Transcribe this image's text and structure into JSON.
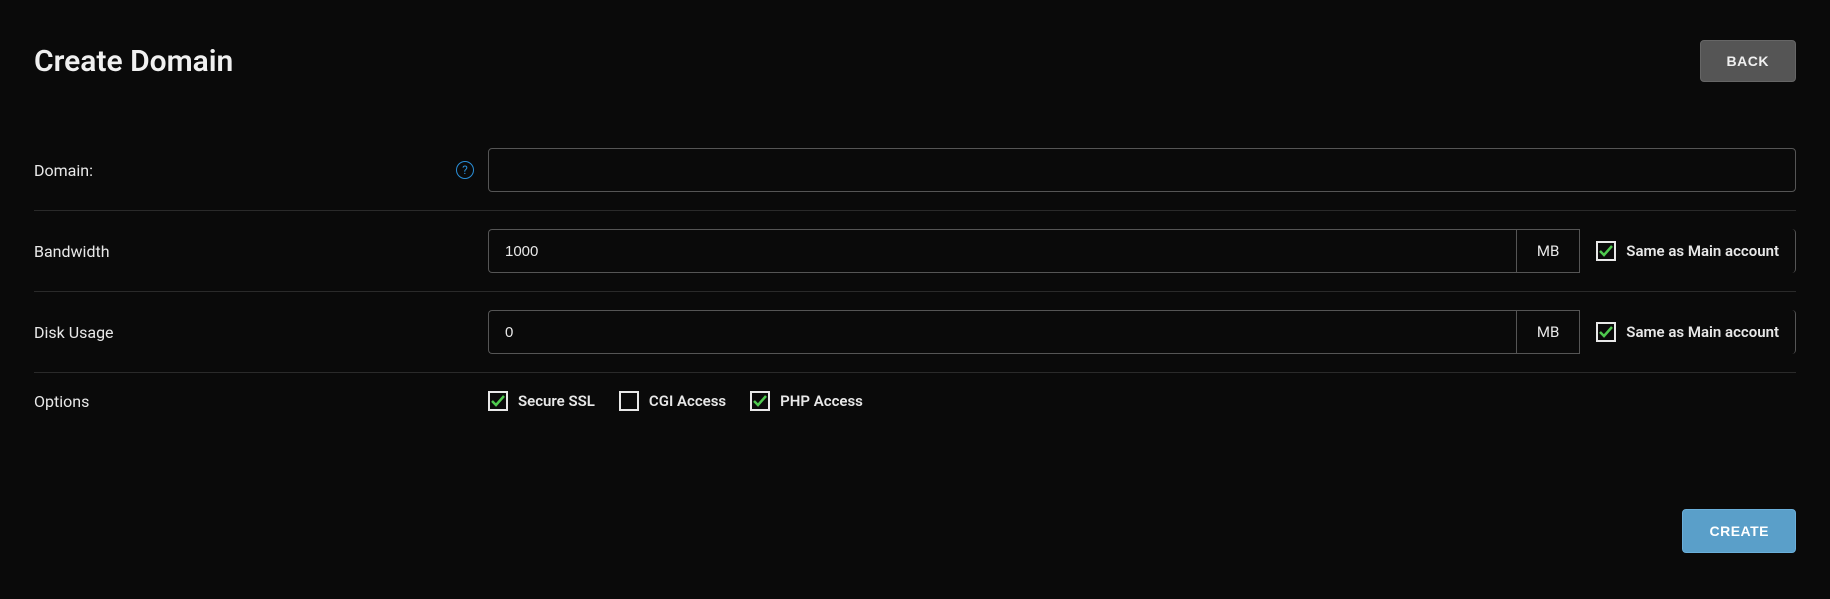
{
  "header": {
    "title": "Create Domain",
    "back_label": "BACK"
  },
  "form": {
    "domain": {
      "label": "Domain:",
      "value": "",
      "help": "?"
    },
    "bandwidth": {
      "label": "Bandwidth",
      "value": "1000",
      "unit": "MB",
      "same_label": "Same as Main account",
      "same_checked": true
    },
    "disk_usage": {
      "label": "Disk Usage",
      "value": "0",
      "unit": "MB",
      "same_label": "Same as Main account",
      "same_checked": true
    },
    "options": {
      "label": "Options",
      "secure_ssl": {
        "label": "Secure SSL",
        "checked": true
      },
      "cgi_access": {
        "label": "CGI Access",
        "checked": false
      },
      "php_access": {
        "label": "PHP Access",
        "checked": true
      }
    }
  },
  "footer": {
    "create_label": "CREATE"
  }
}
